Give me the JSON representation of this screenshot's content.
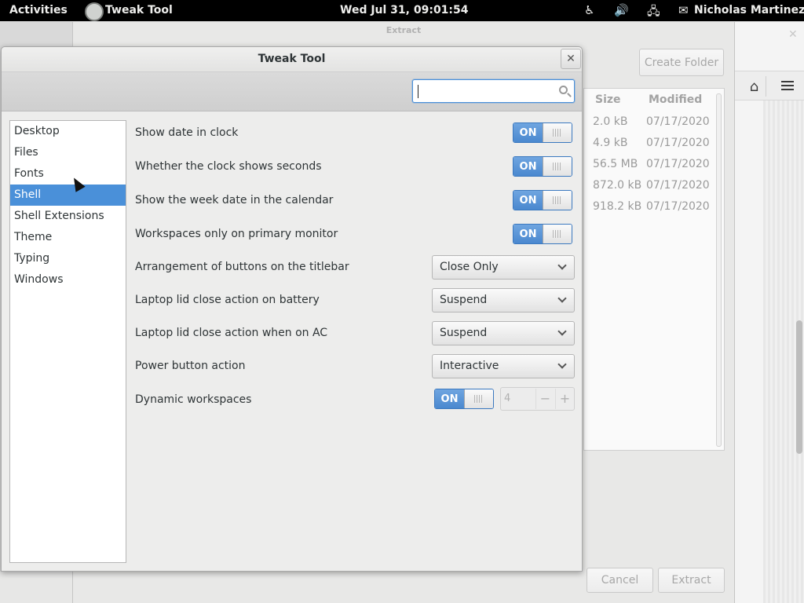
{
  "panel": {
    "activities": "Activities",
    "app_name": "Tweak Tool",
    "clock": "Wed Jul 31, 09:01:54",
    "user": "Nicholas Martinez",
    "icons": [
      "accessibility-icon",
      "volume-icon",
      "network-icon",
      "user-icon"
    ]
  },
  "extract": {
    "title": "Extract",
    "create_folder": "Create Folder",
    "cancel": "Cancel",
    "extract_button": "Extract",
    "columns": [
      "Size",
      "Modified"
    ],
    "files": [
      {
        "size": "2.0 kB",
        "modified": "07/17/2020"
      },
      {
        "size": "4.9 kB",
        "modified": "07/17/2020"
      },
      {
        "size": "56.5 MB",
        "modified": "07/17/2020"
      },
      {
        "size": "872.0 kB",
        "modified": "07/17/2020"
      },
      {
        "size": "918.2 kB",
        "modified": "07/17/2020"
      }
    ]
  },
  "tweak": {
    "title": "Tweak Tool",
    "close": "✕",
    "search_placeholder": "",
    "sidebar": [
      {
        "label": "Desktop",
        "selected": false
      },
      {
        "label": "Files",
        "selected": false
      },
      {
        "label": "Fonts",
        "selected": false
      },
      {
        "label": "Shell",
        "selected": true
      },
      {
        "label": "Shell Extensions",
        "selected": false
      },
      {
        "label": "Theme",
        "selected": false
      },
      {
        "label": "Typing",
        "selected": false
      },
      {
        "label": "Windows",
        "selected": false
      }
    ],
    "settings": {
      "show_date": {
        "label": "Show date in clock",
        "state": "ON"
      },
      "clock_seconds": {
        "label": "Whether the clock shows seconds",
        "state": "ON"
      },
      "week_date": {
        "label": "Show the week date in the calendar",
        "state": "ON"
      },
      "workspaces_primary": {
        "label": "Workspaces only on primary monitor",
        "state": "ON"
      },
      "titlebar_buttons": {
        "label": "Arrangement of buttons on the titlebar",
        "value": "Close Only"
      },
      "lid_battery": {
        "label": "Laptop lid close action on battery",
        "value": "Suspend"
      },
      "lid_ac": {
        "label": "Laptop lid close action when on AC",
        "value": "Suspend"
      },
      "power_button": {
        "label": "Power button action",
        "value": "Interactive"
      },
      "dynamic_workspaces": {
        "label": "Dynamic workspaces",
        "state": "ON",
        "count": "4",
        "minus": "−",
        "plus": "+"
      }
    }
  },
  "colors": {
    "accent": "#4a90d9",
    "panel_bg": "#000000"
  }
}
